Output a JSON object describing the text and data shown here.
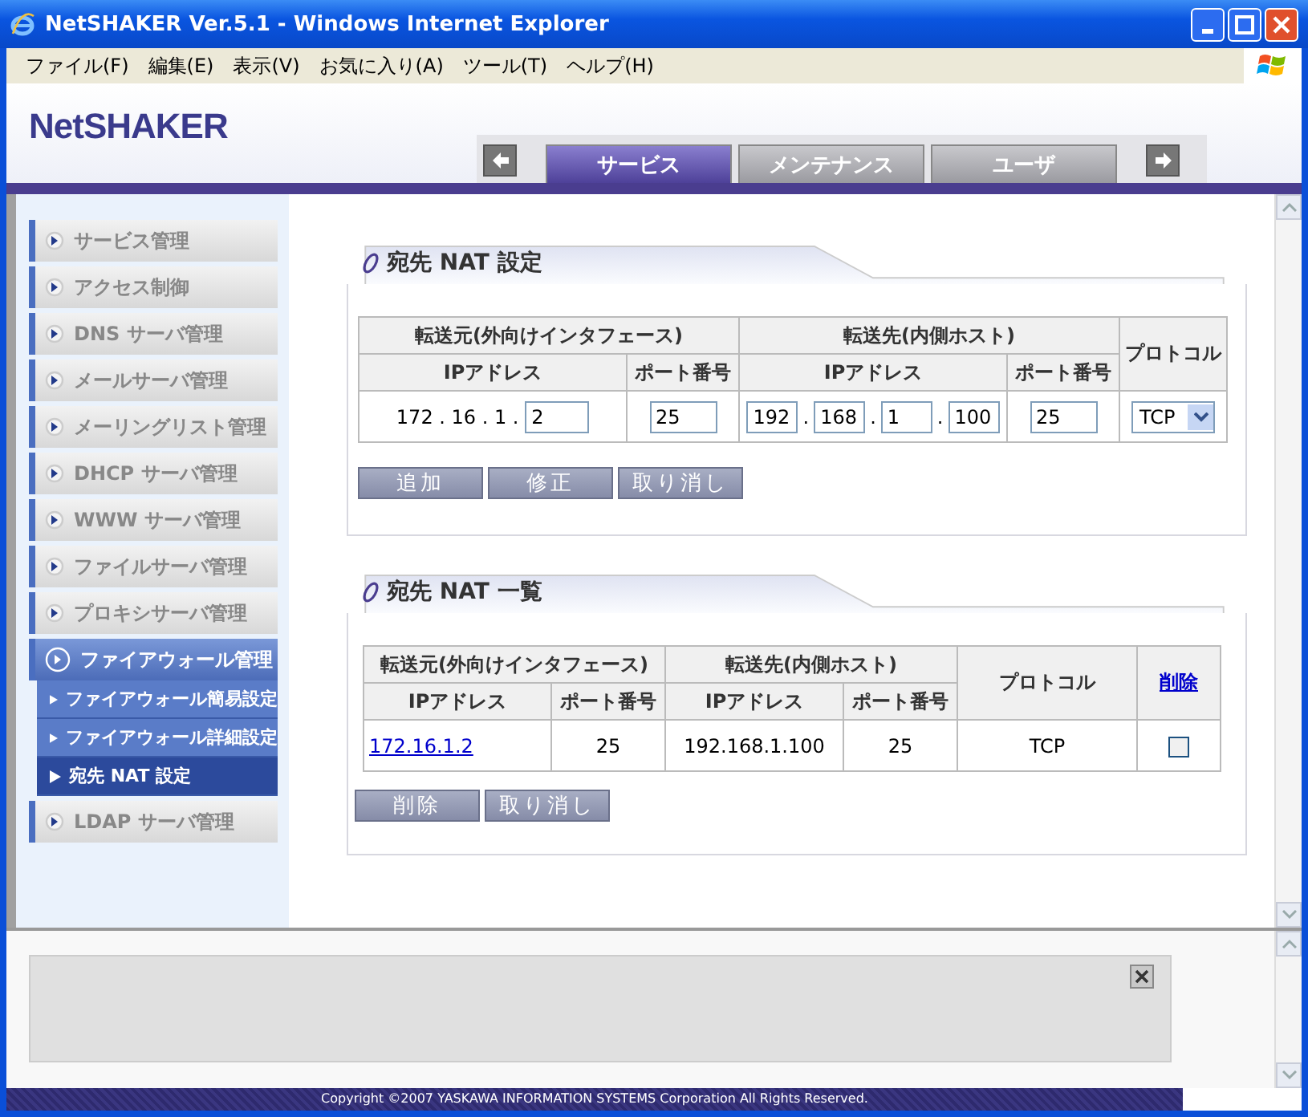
{
  "window": {
    "title": "NetSHAKER Ver.5.1 - Windows Internet Explorer"
  },
  "menu": [
    "ファイル(F)",
    "編集(E)",
    "表示(V)",
    "お気に入り(A)",
    "ツール(T)",
    "ヘルプ(H)"
  ],
  "logo": "NetSHAKER",
  "tabs": [
    {
      "label": "サービス",
      "selected": true
    },
    {
      "label": "メンテナンス",
      "selected": false
    },
    {
      "label": "ユーザ",
      "selected": false
    }
  ],
  "sidebar": {
    "items": [
      {
        "label": "サービス管理",
        "selected": false
      },
      {
        "label": "アクセス制御",
        "selected": false
      },
      {
        "label": "DNS サーバ管理",
        "selected": false
      },
      {
        "label": "メールサーバ管理",
        "selected": false
      },
      {
        "label": "メーリングリスト管理",
        "selected": false
      },
      {
        "label": "DHCP サーバ管理",
        "selected": false
      },
      {
        "label": "WWW サーバ管理",
        "selected": false
      },
      {
        "label": "ファイルサーバ管理",
        "selected": false
      },
      {
        "label": "プロキシサーバ管理",
        "selected": false
      },
      {
        "label": "ファイアウォール管理",
        "selected": true,
        "children": [
          {
            "label": "ファイアウォール簡易設定",
            "selected": false
          },
          {
            "label": "ファイアウォール詳細設定",
            "selected": false
          },
          {
            "label": "宛先 NAT 設定",
            "selected": true
          }
        ]
      },
      {
        "label": "LDAP サーバ管理",
        "selected": false
      }
    ]
  },
  "nat_form": {
    "title": "宛先 NAT 設定",
    "group_headers": [
      "転送元(外向けインタフェース)",
      "転送先(内側ホスト)"
    ],
    "columns": [
      "IPアドレス",
      "ポート番号",
      "IPアドレス",
      "ポート番号",
      "プロトコル"
    ],
    "src_ip_prefix": "172 . 16 . 1 .",
    "src_ip_last": "2",
    "src_port": "25",
    "dst_ip": {
      "parts": [
        "192",
        "168",
        "1",
        "100"
      ],
      "separators": [
        ".",
        ".",
        "."
      ]
    },
    "dst_port": "25",
    "protocol": "TCP",
    "buttons": [
      "追加",
      "修正",
      "取り消し"
    ]
  },
  "nat_list": {
    "title": "宛先 NAT 一覧",
    "group_headers": [
      "転送元(外向けインタフェース)",
      "転送先(内側ホスト)"
    ],
    "columns": [
      "IPアドレス",
      "ポート番号",
      "IPアドレス",
      "ポート番号",
      "プロトコル",
      "削除"
    ],
    "rows": [
      {
        "cells": [
          "172.16.1.2",
          "25",
          "192.168.1.100",
          "25",
          "TCP"
        ],
        "checked": false
      }
    ],
    "buttons": [
      "削除",
      "取り消し"
    ]
  },
  "footer": "Copyright ©2007 YASKAWA INFORMATION SYSTEMS Corporation All Rights Reserved."
}
